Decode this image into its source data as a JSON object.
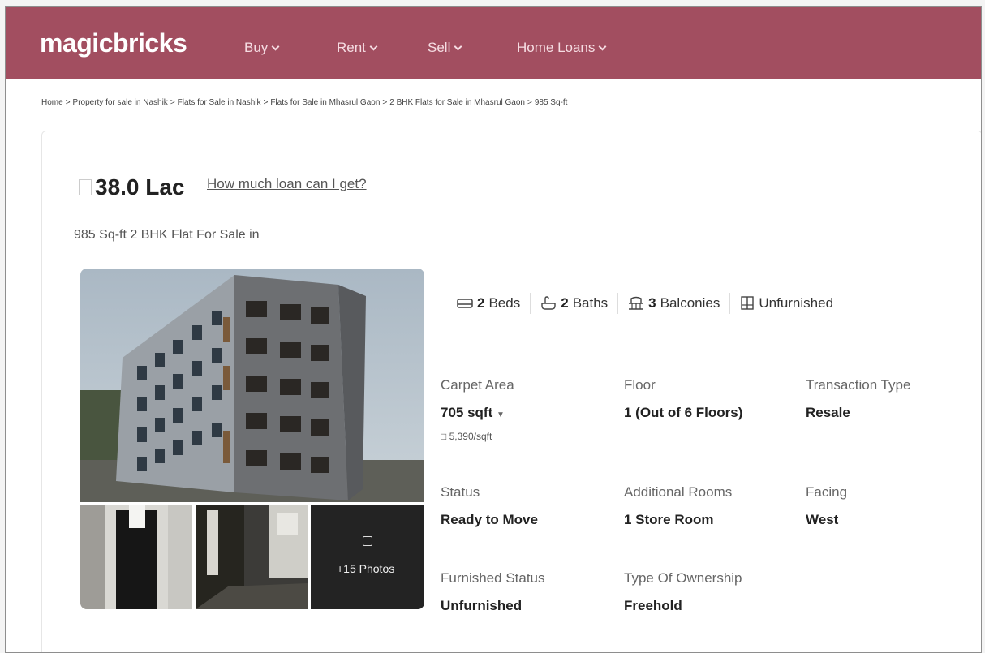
{
  "brand": {
    "logo": "magicbricks",
    "color": "#a24e60"
  },
  "nav": {
    "items": [
      {
        "label": "Buy"
      },
      {
        "label": "Rent"
      },
      {
        "label": "Sell"
      },
      {
        "label": "Home Loans"
      }
    ]
  },
  "breadcrumb": {
    "items": [
      "Home",
      "Property for sale in Nashik",
      "Flats for Sale in Nashik",
      "Flats for Sale in Mhasrul Gaon",
      "2 BHK Flats for Sale in Mhasrul Gaon",
      "985 Sq-ft"
    ],
    "separator": ">"
  },
  "listing": {
    "price": "38.0 Lac",
    "loan_link": "How much loan can I get?",
    "subtitle": "985 Sq-ft 2 BHK Flat For Sale in",
    "photos_label": "+15 Photos",
    "amenities": {
      "beds_count": "2",
      "beds_label": "Beds",
      "baths_count": "2",
      "baths_label": "Baths",
      "balconies_count": "3",
      "balconies_label": "Balconies",
      "furnishing": "Unfurnished"
    },
    "facts": {
      "carpet_area_label": "Carpet Area",
      "carpet_area_value": "705 sqft",
      "price_per_sqft": "5,390/sqft",
      "floor_label": "Floor",
      "floor_value": "1 (Out of 6 Floors)",
      "transaction_label": "Transaction Type",
      "transaction_value": "Resale",
      "status_label": "Status",
      "status_value": "Ready to Move",
      "additional_rooms_label": "Additional Rooms",
      "additional_rooms_value": "1 Store Room",
      "facing_label": "Facing",
      "facing_value": "West",
      "furnished_label": "Furnished Status",
      "furnished_value": "Unfurnished",
      "ownership_label": "Type Of Ownership",
      "ownership_value": "Freehold"
    }
  }
}
